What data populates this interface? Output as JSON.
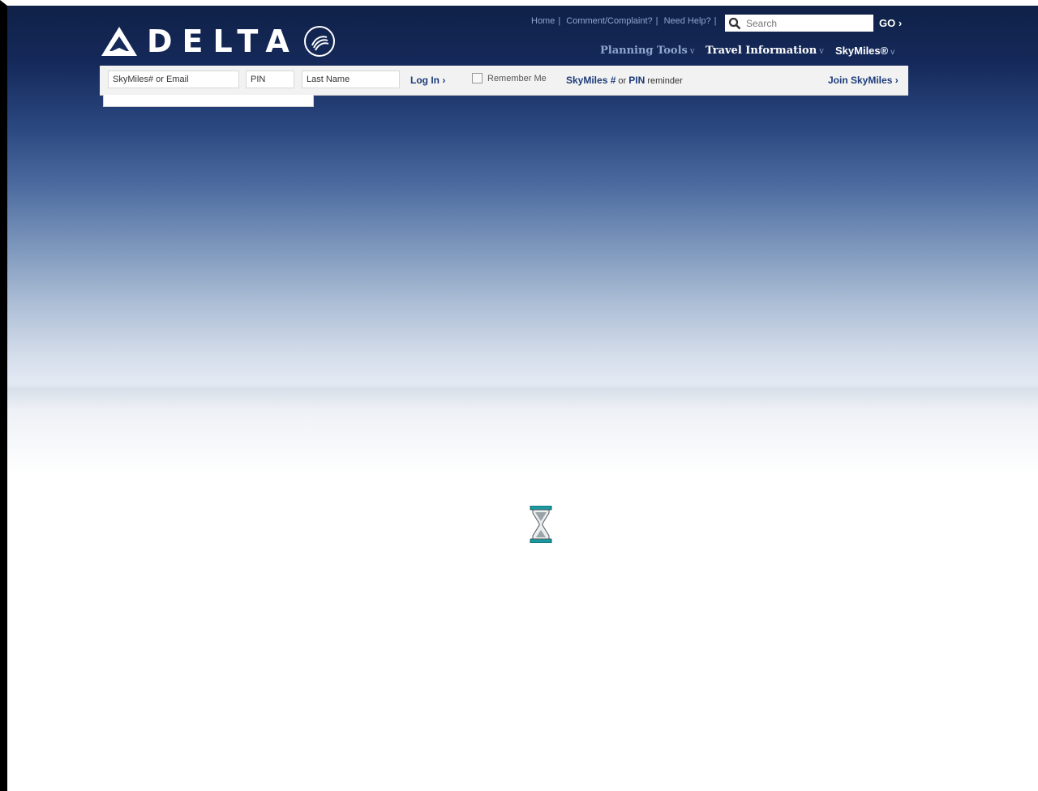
{
  "logo": {
    "text": "DELTA"
  },
  "top_links": {
    "home": "Home",
    "comment": "Comment/Complaint?",
    "help": "Need Help?",
    "separator": "|"
  },
  "search": {
    "placeholder": "Search",
    "go_label": "GO ›"
  },
  "nav": {
    "planning_tools": "Planning Tools",
    "travel_information": "Travel Information",
    "skymiles": "SkyMiles®",
    "chevron": "v"
  },
  "login": {
    "skymiles_placeholder": "SkyMiles# or Email",
    "pin_placeholder": "PIN",
    "lastname_placeholder": "Last Name",
    "login_label": "Log In ›",
    "remember_label": "Remember Me",
    "reminder_skymiles": "SkyMiles #",
    "reminder_or": " or ",
    "reminder_pin": "PIN",
    "reminder_text": " reminder",
    "join_label": "Join SkyMiles ›"
  },
  "colors": {
    "link_blue": "#1d3c7a",
    "nav_light": "#8fa6cf",
    "header_dark": "#0f2147"
  },
  "icons": [
    "delta-widget-icon",
    "skyteam-icon",
    "search-icon",
    "hourglass-icon"
  ]
}
